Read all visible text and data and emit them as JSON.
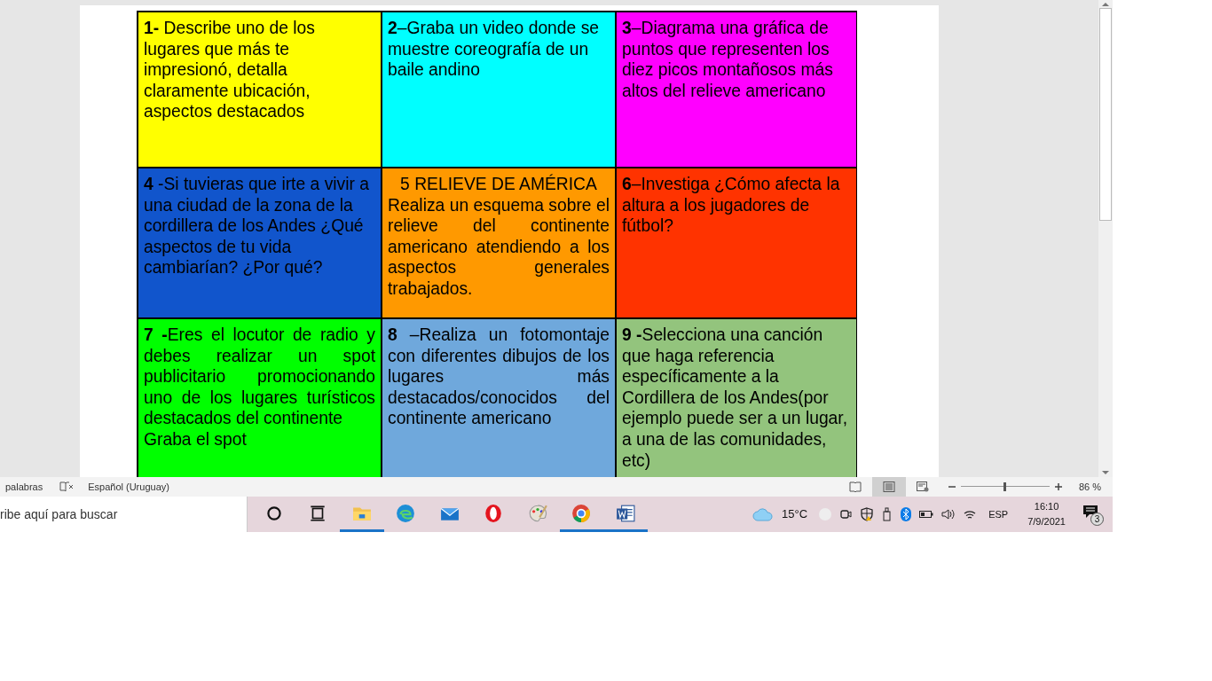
{
  "cells": [
    {
      "color": "#ffff00",
      "lead": "1-",
      "text": " Describe uno de los lugares que más te impresionó, detalla claramente ubicación, aspectos destacados",
      "justify": false
    },
    {
      "color": "#00ffff",
      "lead": "2",
      "text": "–Graba un video donde se muestre coreografía de un baile andino",
      "justify": false
    },
    {
      "color": "#ff00ff",
      "lead": "3",
      "text": "–Diagrama una gráfica de puntos que representen los diez picos  montañosos más altos del relieve americano",
      "justify": false
    },
    {
      "color": "#1155cc",
      "lead": "4",
      "text": "  -Si tuvieras que irte a vivir a una ciudad de la zona de la cordillera de los Andes ¿Qué aspectos de tu vida cambiarían? ¿Por qué?",
      "justify": false
    },
    {
      "color": "#ff9900",
      "heading": "5 RELIEVE DE AMÉRICA",
      "text": "Realiza un esquema sobre el relieve del continente americano atendiendo a los aspectos generales trabajados.",
      "justify": true
    },
    {
      "color": "#ff3300",
      "lead": "6",
      "text": "–Investiga ¿Cómo afecta la altura a los jugadores de fútbol?",
      "justify": false
    },
    {
      "color": "#00ff00",
      "lead": "7  -",
      "text": "Eres el locutor de radio y debes realizar un spot publicitario promocionando uno de los lugares turísticos destacados del continente\n Graba el spot",
      "justify": true
    },
    {
      "color": "#6fa8dc",
      "lead": "8",
      "text": " –Realiza un fotomontaje con diferentes dibujos de los lugares más destacados/conocidos del continente americano",
      "justify": true
    },
    {
      "color": "#93c47d",
      "lead": "9  -",
      "text": "Selecciona una canción que haga referencia específicamente a la Cordillera de los Andes(por ejemplo puede ser a un lugar, a una de las comunidades, etc)",
      "justify": false
    }
  ],
  "status_bar": {
    "word_count": "palabras",
    "language": "Español (Uruguay)",
    "views": [
      {
        "kind": "read",
        "selected": false
      },
      {
        "kind": "print",
        "selected": true
      },
      {
        "kind": "web",
        "selected": false
      }
    ],
    "zoom_slider": {
      "level": 0.5
    },
    "zoom": "86 %"
  },
  "taskbar": {
    "search_placeholder": "ribe aquí para buscar",
    "apps": [
      {
        "kind": "cortana",
        "active": false
      },
      {
        "kind": "taskview",
        "active": false
      },
      {
        "kind": "folder",
        "active": true
      },
      {
        "kind": "edge",
        "active": false
      },
      {
        "kind": "mail",
        "active": false
      },
      {
        "kind": "opera",
        "active": false
      },
      {
        "kind": "paint",
        "active": false
      },
      {
        "kind": "chrome",
        "active": true
      },
      {
        "kind": "word",
        "active": true
      }
    ],
    "temperature": "15°C",
    "language": "ESP",
    "time": "16:10",
    "date": "7/9/2021",
    "notifications": "3"
  }
}
